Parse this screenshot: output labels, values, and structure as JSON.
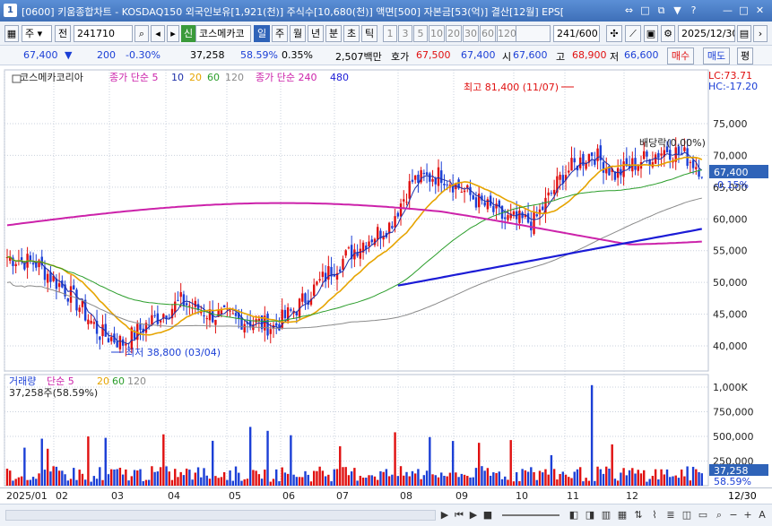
{
  "window": {
    "screen_no": "1",
    "title": "[0600] 키움종합차트 - KOSDAQ150 외국인보유[1,921(천)] 주식수[10,680(천)] 액면[500] 자본금[53(억)] 결산[12월] EPS[",
    "controls": [
      "⇔",
      "□",
      "⧉",
      "▼",
      "?",
      "—",
      "□",
      "✕"
    ]
  },
  "toolbar": {
    "period_select": "주",
    "prev_label": "전",
    "code": "241710",
    "credit_tag": "신",
    "stock_name": "코스메카코",
    "periods": [
      "일",
      "주",
      "월",
      "년",
      "분",
      "초",
      "틱"
    ],
    "active_period": "일",
    "minutes": [
      "1",
      "3",
      "5",
      "10",
      "20",
      "30",
      "60",
      "120"
    ],
    "count": "241",
    "count_total": "/600",
    "date": "2025/12/30"
  },
  "quote": {
    "price": "67,400",
    "change": "200",
    "change_pct": "-0.30%",
    "volume": "37,258",
    "volume_ratio": "58.59%",
    "turnover": "0.35%",
    "amount": "2,507백만",
    "bid_label": "호가",
    "bid1": "67,500",
    "bid2": "67,400",
    "open_label": "시",
    "open": "67,600",
    "high_label": "고",
    "high": "68,900",
    "low_label": "저",
    "low": "66,600",
    "buy_label": "매수",
    "sell_label": "매도",
    "eval_label": "평"
  },
  "price_panel": {
    "legend_name": "코스메카코리아",
    "ma_label": "종가 단순",
    "ma_periods": [
      "5",
      "10",
      "20",
      "60",
      "120"
    ],
    "ma2_label": "종가 단순",
    "ma2_periods": [
      "240",
      "480"
    ],
    "lc": "LC:73.71",
    "hc": "HC:-17.20",
    "high_note": "최고 81,400 (11/07)",
    "low_note": "최저 38,800 (03/04)",
    "dividend_note": "배당락(0.00%)",
    "current_tag": "67,400",
    "current_pct": "-0.15%",
    "y_ticks": [
      "75,000",
      "70,000",
      "65,000",
      "60,000",
      "55,000",
      "50,000",
      "45,000",
      "40,000"
    ]
  },
  "volume_panel": {
    "label": "거래량",
    "ma_label": "단순",
    "ma_periods": [
      "5",
      "20",
      "60",
      "120"
    ],
    "current": "37,258주(58.59%)",
    "y_ticks": [
      "1,000K",
      "750,000",
      "500,000",
      "250,000"
    ],
    "tag1": "37,258",
    "tag2": "58.59%"
  },
  "x_axis": {
    "labels": [
      "2025/01",
      "02",
      "03",
      "04",
      "05",
      "06",
      "07",
      "08",
      "09",
      "10",
      "11",
      "12"
    ],
    "end_label": "12/30"
  },
  "colors": {
    "up": "#e01010",
    "down": "#1b3fd6",
    "ma5": "#1d2fa8",
    "ma20": "#e6a400",
    "ma60": "#2a9d2a",
    "ma120": "#8a8a8a",
    "ma240": "#cc22aa",
    "ma480": "#1b1bd6"
  }
}
